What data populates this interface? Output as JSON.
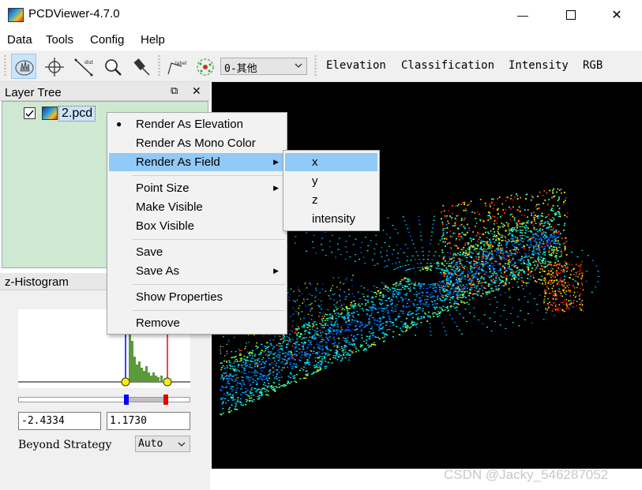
{
  "window": {
    "title": "PCDViewer-4.7.0",
    "minimize_glyph": "—",
    "maximize_glyph": "☐",
    "close_glyph": "✕"
  },
  "menubar": {
    "items": [
      "Data",
      "Tools",
      "Config",
      "Help"
    ]
  },
  "toolbar": {
    "tools": [
      "select-icon",
      "crosshair-icon",
      "measure-distance-icon",
      "zoom-icon",
      "pick-icon",
      "label-icon",
      "points-icon"
    ],
    "measure_text": "dist",
    "label_text": "label",
    "class_select_value": "0-其他",
    "render_buttons": [
      "Elevation",
      "Classification",
      "Intensity",
      "RGB"
    ]
  },
  "layer_tree": {
    "title": "Layer Tree",
    "float_glyph": "⧉",
    "close_glyph": "✕",
    "item_label": "2.pcd",
    "item_checked": true
  },
  "histogram": {
    "title": "z-Histogram",
    "min_value": "-2.4334",
    "max_value": "1.1730",
    "beyond_label": "Beyond Strategy",
    "beyond_value": "Auto"
  },
  "context_menu": {
    "items": [
      {
        "label": "Render As Elevation",
        "checked": true
      },
      {
        "label": "Render As Mono Color"
      },
      {
        "label": "Render As Field",
        "submenu": true,
        "highlighted": true
      },
      {
        "label": "Point Size",
        "submenu": true
      },
      {
        "label": "Make Visible"
      },
      {
        "label": "Box Visible"
      },
      {
        "label": "Save"
      },
      {
        "label": "Save As",
        "submenu": true
      },
      {
        "label": "Show Properties"
      },
      {
        "label": "Remove"
      }
    ]
  },
  "field_submenu": {
    "items": [
      {
        "label": "x",
        "highlighted": true
      },
      {
        "label": "y"
      },
      {
        "label": "z"
      },
      {
        "label": "intensity"
      }
    ]
  },
  "watermark": "CSDN @Jacky_546287052",
  "colors": {
    "accent": "#91c9f7",
    "tree_bg": "#cfe8d2",
    "viewport": "#000000"
  }
}
